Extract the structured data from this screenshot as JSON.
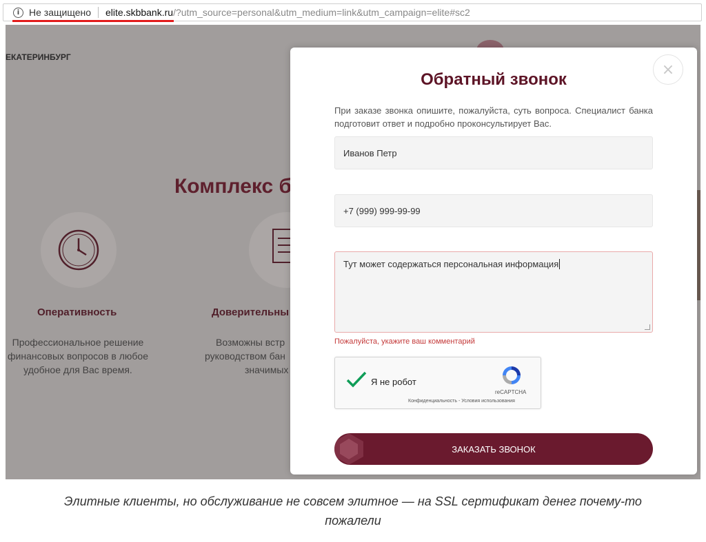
{
  "browser": {
    "security_label": "Не защищено",
    "url_host": "elite.skbbank.ru",
    "url_rest": "/?utm_source=personal&utm_medium=link&utm_campaign=elite#sc2",
    "info_icon_glyph": "i"
  },
  "page": {
    "city": "ЕКАТЕРИНБУРГ",
    "heading": "Комплекс б",
    "features": [
      {
        "title": "Оперативность",
        "text": [
          "Профессиональное решение",
          "финансовых вопросов в любое",
          "удобное для Вас время."
        ]
      },
      {
        "title": "Доверительны",
        "text": [
          "Возможны встр",
          "руководством бан",
          "значимых"
        ]
      }
    ]
  },
  "modal": {
    "close_glyph": "×",
    "title": "Обратный звонок",
    "description": "При заказе звонка опишите, пожалуйста, суть вопроса. Специалист банка подготовит ответ и подробно проконсультирует Вас.",
    "name_value": "Иванов Петр",
    "phone_value": "+7 (999) 999-99-99",
    "comment_value": "Тут может содержаться персональная информация",
    "error_text": "Пожалуйста, укажите ваш комментарий",
    "recaptcha": {
      "label": "Я не робот",
      "brand": "reCAPTCHA",
      "links": "Конфиденциальность - Условия использования"
    },
    "submit_label": "ЗАКАЗАТЬ ЗВОНОК"
  },
  "caption": {
    "line1": "Элитные клиенты, но обслуживание не совсем элитное — на SSL сертификат денег почему-то",
    "line2": "пожалели"
  },
  "colors": {
    "brand": "#6a1a2e",
    "title": "#5d1426",
    "error": "#c43a3a",
    "warning_underline": "#e21b1b"
  }
}
